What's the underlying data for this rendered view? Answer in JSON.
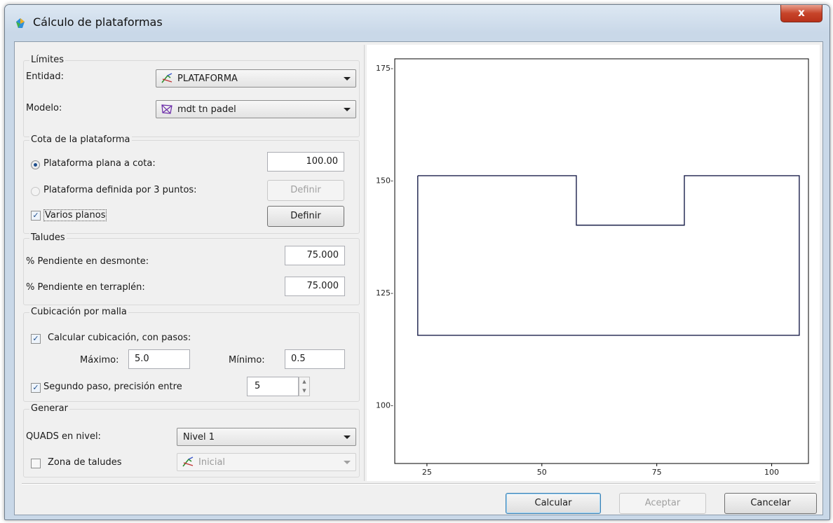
{
  "window": {
    "title": "Cálculo de plataformas",
    "close_label": "x"
  },
  "limites": {
    "title": "Límites",
    "entidad_label": "Entidad:",
    "entidad_value": "PLATAFORMA",
    "modelo_label": "Modelo:",
    "modelo_value": "mdt tn padel"
  },
  "cota": {
    "title": "Cota de la plataforma",
    "plana_label": "Plataforma plana a cota:",
    "plana_value": "100.00",
    "tres_puntos_label": "Plataforma definida por 3 puntos:",
    "definir_disabled_label": "Definir",
    "varios_planos_label": "Varios planos",
    "definir_label": "Definir"
  },
  "taludes": {
    "title": "Taludes",
    "desmonte_label": "% Pendiente en desmonte:",
    "desmonte_value": "75.000",
    "terraplen_label": "% Pendiente en terraplén:",
    "terraplen_value": "75.000"
  },
  "cubicacion": {
    "title": "Cubicación por malla",
    "calcular_label": "Calcular cubicación, con pasos:",
    "maximo_label": "Máximo:",
    "maximo_value": "5.0",
    "minimo_label": "Mínimo:",
    "minimo_value": "0.5",
    "segundo_label": "Segundo paso, precisión entre",
    "segundo_value": "5"
  },
  "generar": {
    "title": "Generar",
    "quads_label": "QUADS en nivel:",
    "quads_value": "Nivel 1",
    "zona_label": "Zona de taludes",
    "zona_value": "Inicial"
  },
  "buttons": {
    "calcular": "Calcular",
    "aceptar": "Aceptar",
    "cancelar": "Cancelar"
  },
  "chart_data": {
    "type": "line",
    "title": "",
    "xlabel": "",
    "ylabel": "",
    "xlim": [
      18,
      108
    ],
    "ylim": [
      87,
      177
    ],
    "x_ticks": [
      25,
      50,
      75,
      100
    ],
    "y_ticks": [
      100,
      125,
      150,
      175
    ],
    "x_tick_labels": [
      "25",
      "50",
      "75",
      "100"
    ],
    "y_tick_labels": [
      "100-",
      "125-",
      "150-",
      "175-"
    ],
    "series": [
      {
        "color": "#1a1f4a",
        "x": [
          23,
          57.5,
          57.5,
          81,
          81,
          106,
          106,
          96,
          81,
          23,
          23
        ],
        "y": [
          151,
          151,
          140,
          140,
          151,
          151,
          115.5,
          115.5,
          115.5,
          115.5,
          151
        ]
      }
    ],
    "grid": false
  },
  "colors": {
    "accent": "#3c7fb1",
    "close": "#c7442a",
    "plot_line": "#1a1f4a"
  }
}
